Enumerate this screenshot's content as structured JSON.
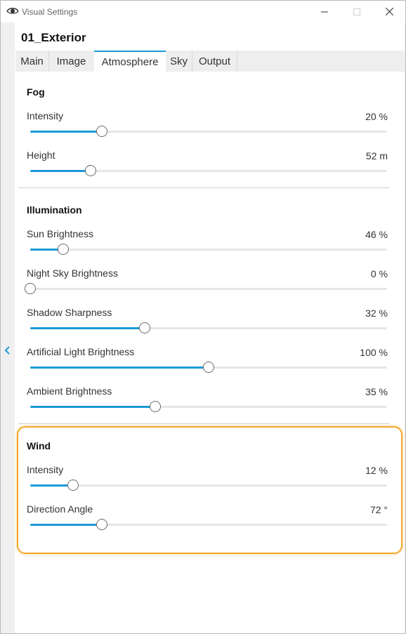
{
  "window": {
    "title": "Visual Settings"
  },
  "document": {
    "title": "01_Exterior"
  },
  "tabs": [
    {
      "label": "Main",
      "active": false
    },
    {
      "label": "Image",
      "active": false
    },
    {
      "label": "Atmosphere",
      "active": true
    },
    {
      "label": "Sky",
      "active": false
    },
    {
      "label": "Output",
      "active": false
    }
  ],
  "sections": {
    "fog": {
      "title": "Fog",
      "rows": [
        {
          "label": "Intensity",
          "value": "20 %",
          "fraction": 0.2
        },
        {
          "label": "Height",
          "value": "52 m",
          "fraction": 0.17
        }
      ]
    },
    "illumination": {
      "title": "Illumination",
      "rows": [
        {
          "label": "Sun Brightness",
          "value": "46 %",
          "fraction": 0.092
        },
        {
          "label": "Night Sky Brightness",
          "value": "0 %",
          "fraction": 0.0
        },
        {
          "label": "Shadow Sharpness",
          "value": "32 %",
          "fraction": 0.32
        },
        {
          "label": "Artificial Light Brightness",
          "value": "100 %",
          "fraction": 0.5
        },
        {
          "label": "Ambient Brightness",
          "value": "35 %",
          "fraction": 0.35
        }
      ]
    },
    "wind": {
      "title": "Wind",
      "rows": [
        {
          "label": "Intensity",
          "value": "12 %",
          "fraction": 0.12
        },
        {
          "label": "Direction Angle",
          "value": "72 °",
          "fraction": 0.2
        }
      ]
    }
  },
  "colors": {
    "accent": "#1b9ad6",
    "highlight": "#f3a72c"
  },
  "icons": {
    "app": "eye-icon",
    "collapse": "chevron-left-icon"
  }
}
